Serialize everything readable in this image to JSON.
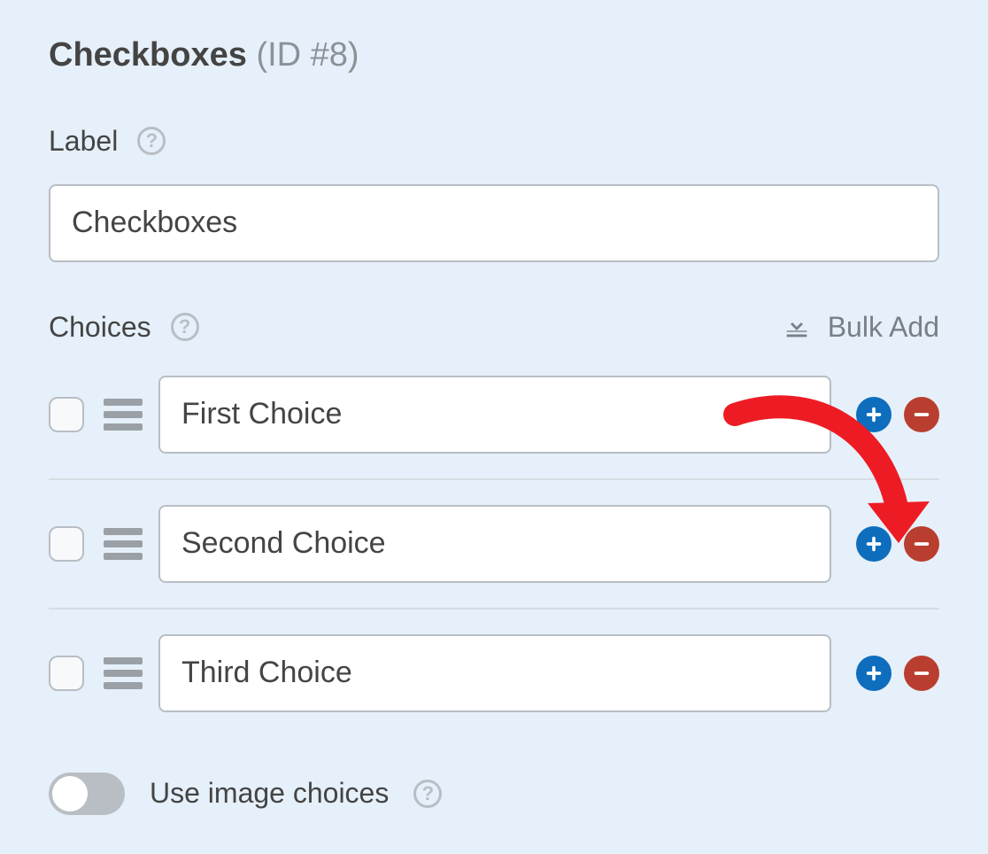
{
  "header": {
    "title": "Checkboxes",
    "id_text": "(ID #8)"
  },
  "label_section": {
    "label": "Label",
    "value": "Checkboxes"
  },
  "choices_section": {
    "label": "Choices",
    "bulk_add": "Bulk Add",
    "items": [
      {
        "value": "First Choice"
      },
      {
        "value": "Second Choice"
      },
      {
        "value": "Third Choice"
      }
    ]
  },
  "image_choices": {
    "label": "Use image choices",
    "enabled": false
  }
}
